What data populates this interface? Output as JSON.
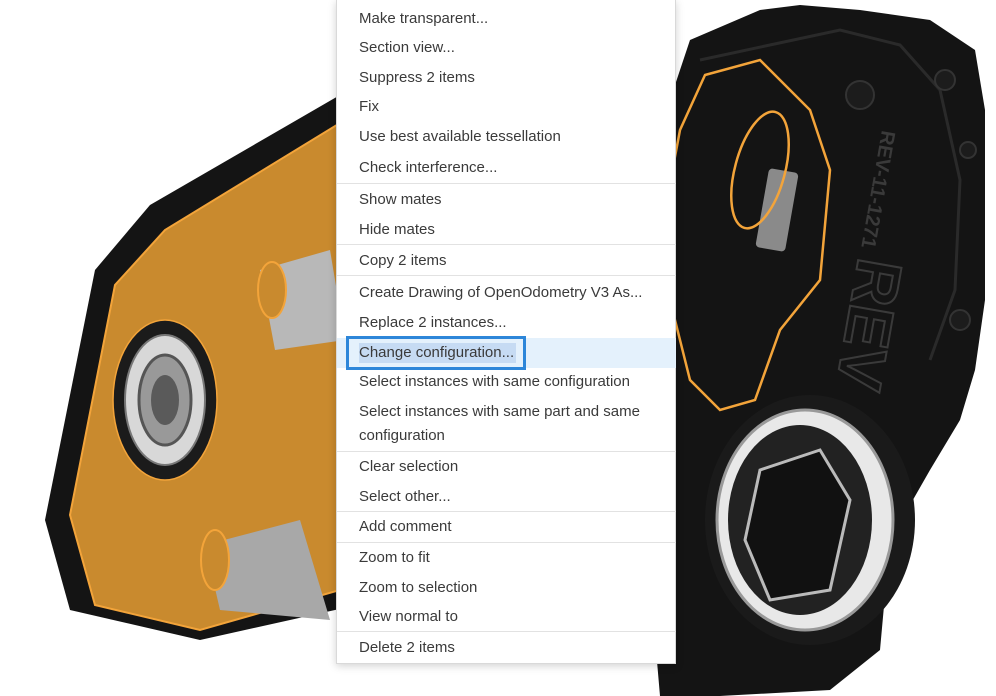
{
  "menu": {
    "items": [
      {
        "label": "Make transparent..."
      },
      {
        "label": "Section view..."
      },
      {
        "label": "Suppress 2 items"
      },
      {
        "label": "Fix"
      },
      {
        "label": "Use best available tessellation"
      },
      {
        "label": "Check interference..."
      },
      {
        "label": "Show mates"
      },
      {
        "label": "Hide mates"
      },
      {
        "label": "Copy 2 items"
      },
      {
        "label": "Create Drawing of OpenOdometry V3 As..."
      },
      {
        "label": "Replace 2 instances..."
      },
      {
        "label": "Change configuration..."
      },
      {
        "label": "Select instances with same configuration"
      },
      {
        "label": "Select instances with same part and same configuration"
      },
      {
        "label": "Clear selection"
      },
      {
        "label": "Select other..."
      },
      {
        "label": "Add comment"
      },
      {
        "label": "Zoom to fit"
      },
      {
        "label": "Zoom to selection"
      },
      {
        "label": "View normal to"
      },
      {
        "label": "Delete 2 items"
      }
    ]
  },
  "model": {
    "part_text": "REV",
    "part_number": "REV-11-1271"
  },
  "colors": {
    "selection_outline": "#f3a43a",
    "plate": "#c98a2e",
    "housing": "#121212",
    "highlight": "#e4f1fc",
    "focus_border": "#2d86d9"
  }
}
